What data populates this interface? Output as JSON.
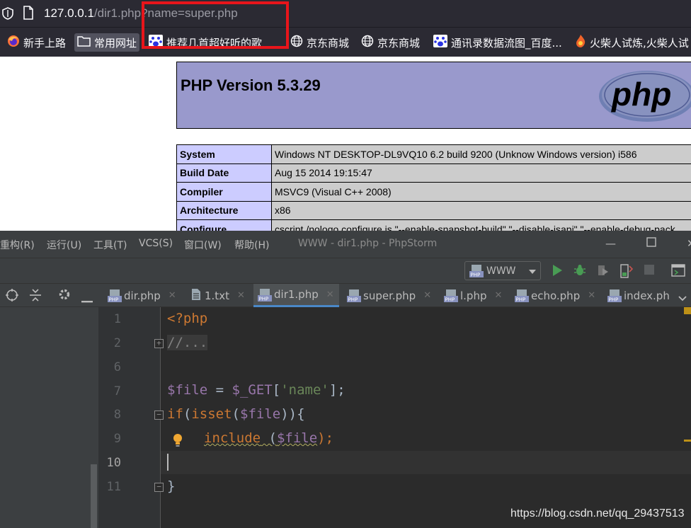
{
  "browser": {
    "url_host": "127.0.0.1",
    "url_path": "/dir1.php",
    "url_query": "?name=super.php",
    "bookmarks": [
      {
        "label": "新手上路",
        "icon": "firefox-icon"
      },
      {
        "label": "常用网址",
        "icon": "folder-icon"
      },
      {
        "label": "推荐几首超好听的歌",
        "icon": "baidu-paw-icon"
      },
      {
        "label": "京东商城",
        "icon": "globe-icon"
      },
      {
        "label": "京东商城",
        "icon": "globe-icon"
      },
      {
        "label": "通讯录数据流图_百度...",
        "icon": "baidu-paw-icon"
      },
      {
        "label": "火柴人试炼,火柴人试",
        "icon": "fire-icon"
      }
    ]
  },
  "phpinfo": {
    "title": "PHP Version 5.3.29",
    "logo_text": "php",
    "rows": [
      {
        "key": "System",
        "value": "Windows NT DESKTOP-DL9VQ10 6.2 build 9200 (Unknow Windows version) i586"
      },
      {
        "key": "Build Date",
        "value": "Aug 15 2014 19:15:47"
      },
      {
        "key": "Compiler",
        "value": "MSVC9 (Visual C++ 2008)"
      },
      {
        "key": "Architecture",
        "value": "x86"
      },
      {
        "key": "Configure",
        "value": "cscript /nologo configure.js \"--enable-snapshot-build\" \"--disable-isapi\" \"--enable-debug-pack"
      }
    ]
  },
  "ide": {
    "menus": [
      "重构(R)",
      "运行(U)",
      "工具(T)",
      "VCS(S)",
      "窗口(W)",
      "帮助(H)"
    ],
    "title": "WWW - dir1.php - PhpStorm",
    "run_config": "WWW",
    "tabs": [
      {
        "label": "dir.php",
        "type": "php"
      },
      {
        "label": "1.txt",
        "type": "txt"
      },
      {
        "label": "dir1.php",
        "type": "php",
        "active": true
      },
      {
        "label": "super.php",
        "type": "php"
      },
      {
        "label": "l.php",
        "type": "php"
      },
      {
        "label": "echo.php",
        "type": "php"
      },
      {
        "label": "index.ph",
        "type": "php"
      }
    ],
    "line_numbers": [
      "1",
      "2",
      "6",
      "7",
      "8",
      "9",
      "10",
      "11"
    ],
    "current_line": "10",
    "code": {
      "open_tag": "<?php",
      "folded": "//...",
      "var_file": "$file",
      "assign": " = ",
      "var_get": "$_GET",
      "bracket_open": "[",
      "str_name": "'name'",
      "bracket_close": "];",
      "kw_if": "if",
      "paren_open": "(",
      "kw_isset": "isset",
      "paren_inner_open": "(",
      "paren_close": ")){",
      "kw_include": "include",
      "include_args_open": " (",
      "include_args_close": ");",
      "closing_brace": "}"
    }
  },
  "watermark": "https://blog.csdn.net/qq_29437513",
  "colors": {
    "highlight_box": "#e8151b",
    "php_header_bg": "#9999cc",
    "php_key_bg": "#ccccff",
    "php_value_bg": "#cccccc",
    "editor_bg": "#2b2b2b",
    "keyword": "#cc7832",
    "variable": "#9876aa",
    "string": "#6a8759"
  }
}
